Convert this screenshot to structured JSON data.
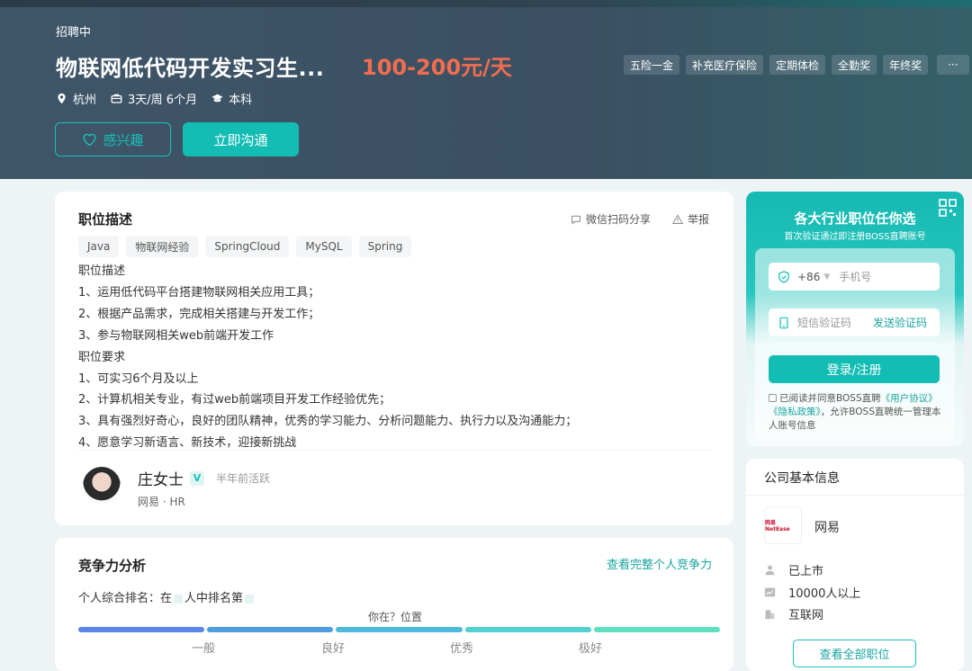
{
  "header": {
    "status": "招聘中",
    "title": "物联网低代码开发实习生...",
    "salary": "100-200元/天",
    "location": "杭州",
    "schedule": "3天/周 6个月",
    "degree": "本科",
    "like_label": "感兴趣",
    "chat_label": "立即沟通",
    "benefits": [
      "五险一金",
      "补充医疗保险",
      "定期体检",
      "全勤奖",
      "年终奖"
    ],
    "more_label": "···"
  },
  "description": {
    "title": "职位描述",
    "share_label": "微信扫码分享",
    "report_label": "举报",
    "tags": [
      "Java",
      "物联网经验",
      "SpringCloud",
      "MySQL",
      "Spring"
    ],
    "lines": [
      "职位描述",
      "1、运用低代码平台搭建物联网相关应用工具；",
      "2、根据产品需求，完成相关搭建与开发工作；",
      "3、参与物联网相关web前端开发工作",
      "职位要求",
      "1、可实习6个月及以上",
      "2、计算机相关专业，有过web前端项目开发工作经验优先；",
      "3、具有强烈好奇心，良好的团队精神，优秀的学习能力、分析问题能力、执行力以及沟通能力；",
      "4、愿意学习新语言、新技术，迎接新挑战"
    ],
    "hr": {
      "name": "庄女士",
      "badge": "V",
      "active": "半年前活跃",
      "company_role": "网易 · HR"
    }
  },
  "competition": {
    "title": "竞争力分析",
    "link": "查看完整个人竞争力",
    "rank_prefix": "个人综合排名：在",
    "rank_middle": "人中排名第",
    "position_label": "你在？位置",
    "levels": [
      "一般",
      "良好",
      "优秀",
      "极好"
    ],
    "colors": [
      "#5b86e5",
      "#4f9fe0",
      "#4dbadb",
      "#53d0d0",
      "#5ee0c0"
    ]
  },
  "login": {
    "heading": "各大行业职位任你选",
    "subheading": "首次验证通过即注册BOSS直聘账号",
    "country_code": "+86",
    "phone_placeholder": "手机号",
    "code_placeholder": "短信验证码",
    "send_code": "发送验证码",
    "submit": "登录/注册",
    "agree_prefix": "已阅读并同意BOSS直聘",
    "agree_link1": "《用户协议》",
    "agree_link2": "《隐私政策》",
    "agree_suffix": "，允许BOSS直聘统一管理本人账号信息"
  },
  "company": {
    "title": "公司基本信息",
    "logo_text": "网易 NetEase",
    "name": "网易",
    "stage": "已上市",
    "size": "10000人以上",
    "industry": "互联网",
    "all_jobs": "查看全部职位"
  },
  "colors": {
    "accent": "#13bdb4",
    "salary": "#f26d4f",
    "header_bg": "#3f5568"
  }
}
